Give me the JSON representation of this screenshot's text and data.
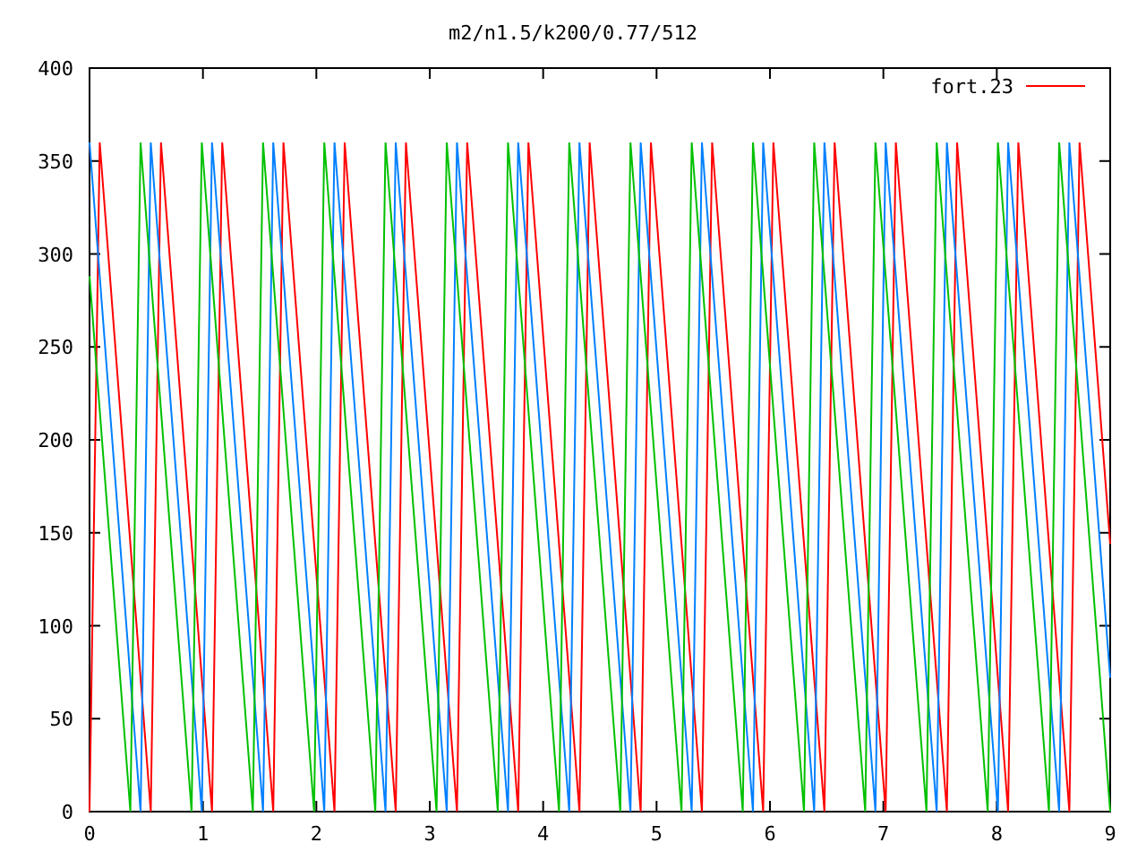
{
  "chart_data": {
    "type": "line",
    "title": "m2/n1.5/k200/0.77/512",
    "x": [
      0,
      0.09,
      0.18,
      0.27,
      0.36,
      0.45,
      0.54,
      0.63,
      0.72,
      0.81,
      0.9,
      0.99,
      1.08,
      1.17,
      1.26,
      1.35,
      1.44,
      1.53,
      1.62,
      1.71,
      1.8,
      1.89,
      1.98,
      2.07,
      2.16,
      2.25,
      2.34,
      2.43,
      2.52,
      2.61,
      2.7,
      2.79,
      2.88,
      2.97,
      3.06,
      3.15,
      3.24,
      3.33,
      3.42,
      3.51,
      3.6,
      3.69,
      3.78,
      3.87,
      3.96,
      4.05,
      4.14,
      4.23,
      4.32,
      4.41,
      4.5,
      4.59,
      4.68,
      4.77,
      4.86,
      4.95,
      5.04,
      5.13,
      5.22,
      5.31,
      5.4,
      5.49,
      5.58,
      5.67,
      5.76,
      5.85,
      5.94,
      6.03,
      6.12,
      6.21,
      6.3,
      6.39,
      6.48,
      6.57,
      6.66,
      6.75,
      6.84,
      6.93,
      7.02,
      7.11,
      7.2,
      7.29,
      7.38,
      7.47,
      7.56,
      7.65,
      7.74,
      7.83,
      7.92,
      8.01,
      8.1,
      8.19,
      8.28,
      8.37,
      8.46,
      8.55,
      8.64,
      8.73,
      8.82,
      8.91,
      9
    ],
    "series": [
      {
        "name": "fort.23",
        "color": "#ff0000",
        "values": [
          0,
          360,
          288,
          216,
          144,
          72,
          0,
          360,
          288,
          216,
          144,
          72,
          0,
          360,
          288,
          216,
          144,
          72,
          0,
          360,
          288,
          216,
          144,
          72,
          0,
          360,
          288,
          216,
          144,
          72,
          0,
          360,
          288,
          216,
          144,
          72,
          0,
          360,
          288,
          216,
          144,
          72,
          0,
          360,
          288,
          216,
          144,
          72,
          0,
          360,
          288,
          216,
          144,
          72,
          0,
          360,
          288,
          216,
          144,
          72,
          0,
          360,
          288,
          216,
          144,
          72,
          0,
          360,
          288,
          216,
          144,
          72,
          0,
          360,
          288,
          216,
          144,
          72,
          0,
          360,
          288,
          216,
          144,
          72,
          0,
          360,
          288,
          216,
          144,
          72,
          0,
          360,
          288,
          216,
          144,
          72,
          0,
          360,
          288,
          216,
          144
        ]
      },
      {
        "color": "#0080ff",
        "values": [
          360,
          288,
          216,
          144,
          72,
          0,
          360,
          288,
          216,
          144,
          72,
          0,
          360,
          288,
          216,
          144,
          72,
          0,
          360,
          288,
          216,
          144,
          72,
          0,
          360,
          288,
          216,
          144,
          72,
          0,
          360,
          288,
          216,
          144,
          72,
          0,
          360,
          288,
          216,
          144,
          72,
          0,
          360,
          288,
          216,
          144,
          72,
          0,
          360,
          288,
          216,
          144,
          72,
          0,
          360,
          288,
          216,
          144,
          72,
          0,
          360,
          288,
          216,
          144,
          72,
          0,
          360,
          288,
          216,
          144,
          72,
          0,
          360,
          288,
          216,
          144,
          72,
          0,
          360,
          288,
          216,
          144,
          72,
          0,
          360,
          288,
          216,
          144,
          72,
          0,
          360,
          288,
          216,
          144,
          72,
          0,
          360,
          288,
          216,
          144,
          72
        ]
      },
      {
        "color": "#00c000",
        "values": [
          288,
          216,
          144,
          72,
          0,
          360,
          288,
          216,
          144,
          72,
          0,
          360,
          288,
          216,
          144,
          72,
          0,
          360,
          288,
          216,
          144,
          72,
          0,
          360,
          288,
          216,
          144,
          72,
          0,
          360,
          288,
          216,
          144,
          72,
          0,
          360,
          288,
          216,
          144,
          72,
          0,
          360,
          288,
          216,
          144,
          72,
          0,
          360,
          288,
          216,
          144,
          72,
          0,
          360,
          288,
          216,
          144,
          72,
          0,
          360,
          288,
          216,
          144,
          72,
          0,
          360,
          288,
          216,
          144,
          72,
          0,
          360,
          288,
          216,
          144,
          72,
          0,
          360,
          288,
          216,
          144,
          72,
          0,
          360,
          288,
          216,
          144,
          72,
          0,
          360,
          288,
          216,
          144,
          72,
          0,
          360,
          288,
          216,
          144,
          72,
          0
        ]
      }
    ],
    "xlim": [
      0,
      9
    ],
    "ylim": [
      0,
      400
    ],
    "xticks": [
      0,
      1,
      2,
      3,
      4,
      5,
      6,
      7,
      8,
      9
    ],
    "yticks": [
      0,
      50,
      100,
      150,
      200,
      250,
      300,
      350,
      400
    ]
  }
}
